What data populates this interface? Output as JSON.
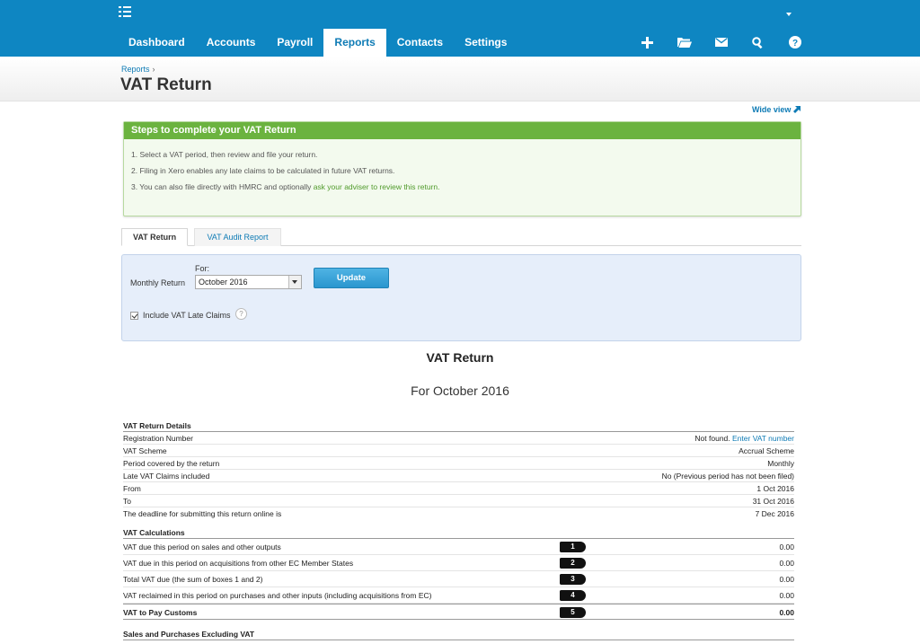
{
  "nav": {
    "items": [
      "Dashboard",
      "Accounts",
      "Payroll",
      "Reports",
      "Contacts",
      "Settings"
    ],
    "active_index": 3,
    "icons": [
      "plus-icon",
      "folder-icon",
      "mail-icon",
      "search-icon",
      "help-icon"
    ]
  },
  "header": {
    "breadcrumb": "Reports",
    "breadcrumb_sep": "›",
    "title": "VAT Return"
  },
  "wide_view": "Wide view",
  "steps": {
    "heading": "Steps to complete your VAT Return",
    "step1": "1. Select a VAT period, then review and file your return.",
    "step2": "2. Filing in Xero enables any late claims to be calculated in future VAT returns.",
    "step3_text": "3. You can also file directly with HMRC and optionally ",
    "step3_link": "ask your adviser to review this return."
  },
  "tabs": [
    "VAT Return",
    "VAT Audit Report"
  ],
  "filter": {
    "period_label": "Monthly Return",
    "for_label": "For:",
    "selected_period": "October 2016",
    "update_label": "Update",
    "late_claims_label": "Include VAT Late Claims",
    "late_claims_checked": true
  },
  "report": {
    "title": "VAT Return",
    "subtitle": "For October 2016",
    "details_heading": "VAT Return Details",
    "details": [
      {
        "label": "Registration Number",
        "value": "Not found. ",
        "link": "Enter VAT number"
      },
      {
        "label": "VAT Scheme",
        "value": "Accrual Scheme"
      },
      {
        "label": "Period covered by the return",
        "value": "Monthly"
      },
      {
        "label": "Late VAT Claims included",
        "value": "No (Previous period has not been filed)"
      },
      {
        "label": "From",
        "value": "1 Oct 2016"
      },
      {
        "label": "To",
        "value": "31 Oct 2016"
      },
      {
        "label": "The deadline for submitting this return online is",
        "value": "7 Dec 2016"
      }
    ],
    "calc_heading": "VAT Calculations",
    "calculations": [
      {
        "label": "VAT due this period on sales and other outputs",
        "box": "1",
        "value": "0.00"
      },
      {
        "label": "VAT due in this period on acquisitions from other EC Member States",
        "box": "2",
        "value": "0.00"
      },
      {
        "label": "Total VAT due (the sum of boxes 1 and 2)",
        "box": "3",
        "value": "0.00"
      },
      {
        "label": "VAT reclaimed in this period on purchases and other inputs (including acquisitions from EC)",
        "box": "4",
        "value": "0.00"
      },
      {
        "label": "VAT to Pay Customs",
        "box": "5",
        "value": "0.00"
      }
    ],
    "sales_heading": "Sales and Purchases Excluding VAT"
  }
}
